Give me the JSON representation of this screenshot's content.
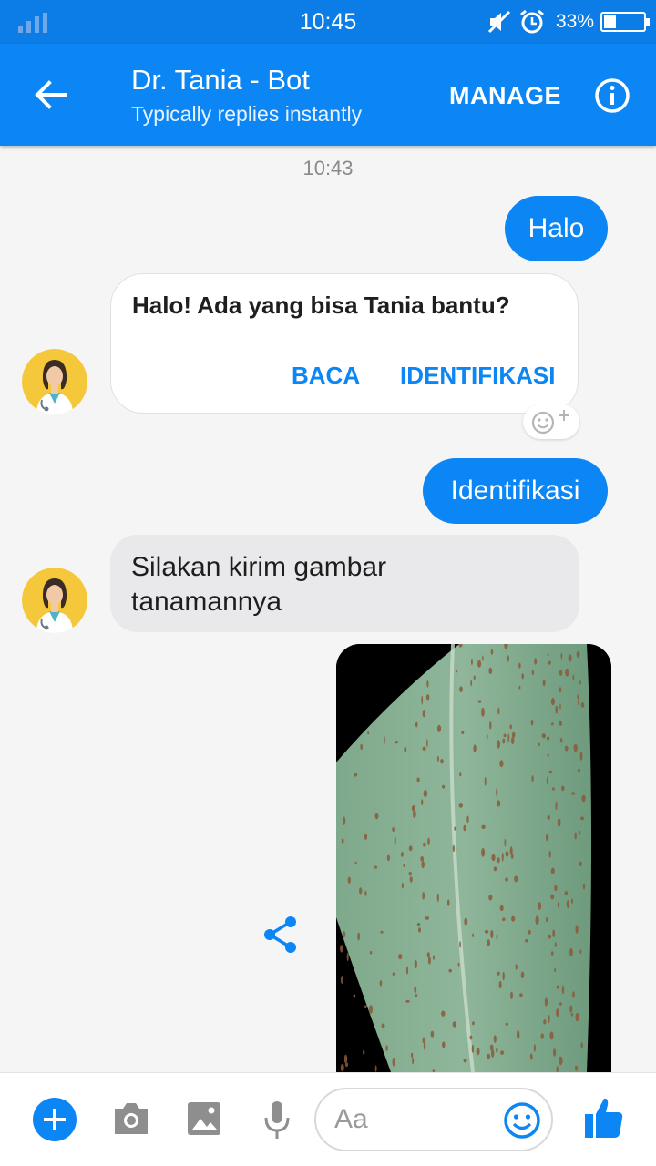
{
  "status_bar": {
    "time": "10:45",
    "battery": "33%"
  },
  "header": {
    "title": "Dr. Tania - Bot",
    "subtitle": "Typically replies instantly",
    "manage_label": "MANAGE"
  },
  "chat": {
    "timestamp": "10:43",
    "messages": {
      "out_1": "Halo",
      "bot_card": {
        "text": "Halo! Ada yang bisa Tania bantu?",
        "buttons": [
          "BACA",
          "IDENTIFIKASI"
        ]
      },
      "out_2": "Identifikasi",
      "in_1": "Silakan kirim gambar tanamannya"
    }
  },
  "composer": {
    "placeholder": "Aa"
  },
  "colors": {
    "brand": "#0c86f4",
    "status_bar": "#0c7ce6",
    "incoming_bubble": "#e9e9eb"
  },
  "icons": [
    "signal-icon",
    "mute-icon",
    "alarm-icon",
    "battery-icon",
    "back-arrow-icon",
    "info-icon",
    "add-reaction-icon",
    "share-icon",
    "plus-icon",
    "camera-icon",
    "gallery-icon",
    "mic-icon",
    "emoji-icon",
    "like-icon"
  ]
}
